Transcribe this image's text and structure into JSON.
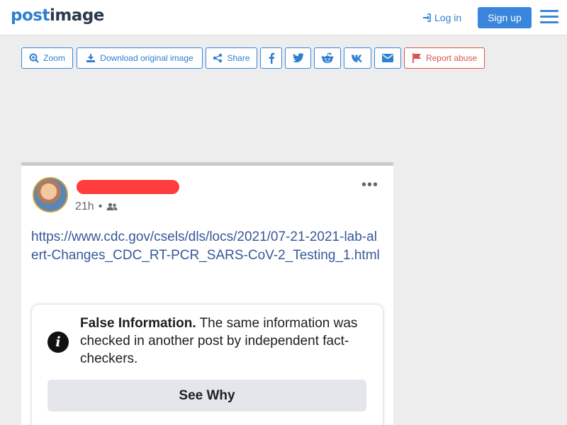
{
  "header": {
    "logo_a": "post",
    "logo_b": "image",
    "login_label": "Log in",
    "signup_label": "Sign up"
  },
  "toolbar": {
    "zoom": "Zoom",
    "download": "Download original image",
    "share": "Share",
    "report": "Report abuse"
  },
  "post": {
    "time": "21h",
    "link_text": "https://www.cdc.gov/csels/dls/locs/2021/07-21-2021-lab-alert-Changes_CDC_RT-PCR_SARS-CoV-2_Testing_1.html",
    "fact_check_bold": "False Information.",
    "fact_check_text": " The same information was checked in another post by independent fact-checkers.",
    "see_why": "See Why"
  },
  "colors": {
    "brand": "#2d7fd3",
    "report": "#d9534f",
    "fb_link": "#385898"
  }
}
